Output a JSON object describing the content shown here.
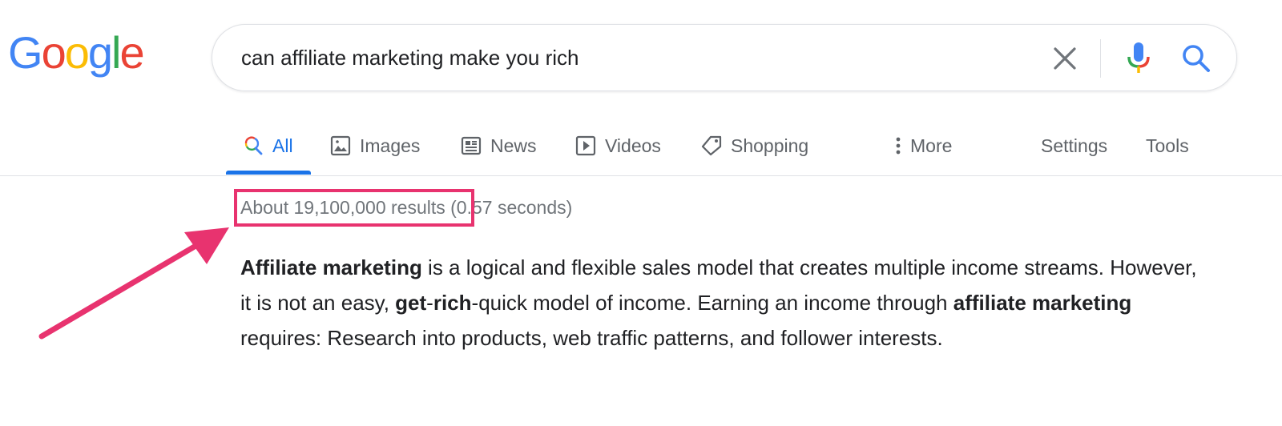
{
  "logo": {
    "letters": [
      {
        "char": "G",
        "color": "#4285F4"
      },
      {
        "char": "o",
        "color": "#EA4335"
      },
      {
        "char": "o",
        "color": "#FBBC05"
      },
      {
        "char": "g",
        "color": "#4285F4"
      },
      {
        "char": "l",
        "color": "#34A853"
      },
      {
        "char": "e",
        "color": "#EA4335"
      }
    ]
  },
  "search": {
    "query": "can affiliate marketing make you rich",
    "clear_icon": "close-icon",
    "mic_icon": "microphone-icon",
    "search_icon": "search-icon"
  },
  "tabs": [
    {
      "label": "All",
      "icon": "search-icon",
      "active": true
    },
    {
      "label": "Images",
      "icon": "image-icon",
      "active": false
    },
    {
      "label": "News",
      "icon": "newspaper-icon",
      "active": false
    },
    {
      "label": "Videos",
      "icon": "play-icon",
      "active": false
    },
    {
      "label": "Shopping",
      "icon": "tag-icon",
      "active": false
    },
    {
      "label": "More",
      "icon": "more-vert-icon",
      "active": false
    },
    {
      "label": "Settings",
      "active": false
    },
    {
      "label": "Tools",
      "active": false
    }
  ],
  "results": {
    "count_text": "About 19,100,000 results",
    "time_text": "(0.57 seconds)"
  },
  "snippet": {
    "parts": [
      {
        "text": "Affiliate marketing",
        "bold": true
      },
      {
        "text": " is a logical and flexible sales model that creates multiple income streams. However, it is not an easy, ",
        "bold": false
      },
      {
        "text": "get",
        "bold": true
      },
      {
        "text": "-",
        "bold": false
      },
      {
        "text": "rich",
        "bold": true
      },
      {
        "text": "-quick model of income. Earning an income through ",
        "bold": false
      },
      {
        "text": "affiliate marketing",
        "bold": true
      },
      {
        "text": " requires: Research into products, web traffic patterns, and follower interests.",
        "bold": false
      }
    ]
  },
  "colors": {
    "accent": "#1a73e8",
    "annotation": "#e8336f",
    "muted_text": "#70757a",
    "tab_text": "#5f6368"
  }
}
